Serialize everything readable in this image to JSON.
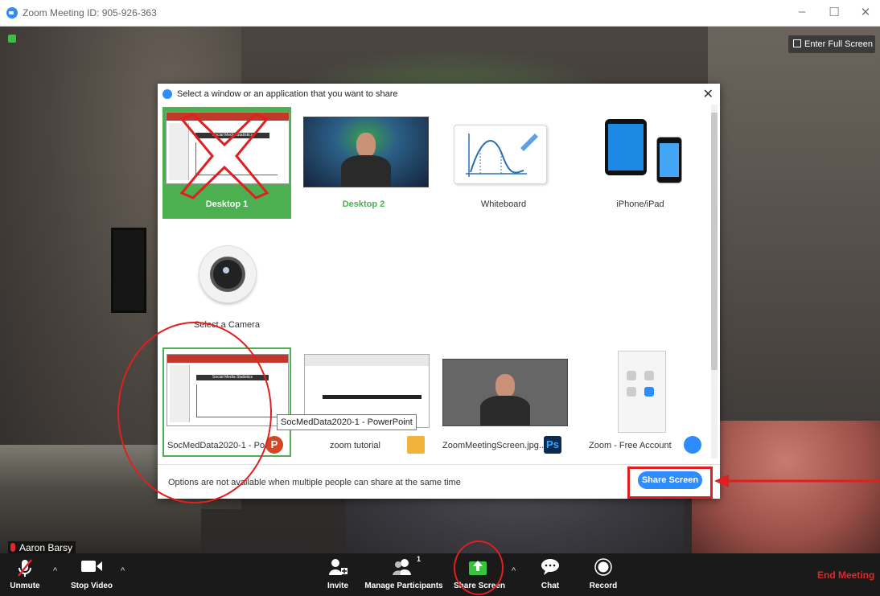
{
  "window": {
    "title": "Zoom Meeting ID: 905-926-363",
    "minimize": "–",
    "maximize": "☐",
    "close": "✕"
  },
  "video": {
    "fullscreen_label": "Enter Full Screen",
    "participant_name": "Aaron Barsy"
  },
  "dialog": {
    "title": "Select a window or an application that you want to share",
    "close": "✕",
    "tiles": [
      {
        "label": "Desktop 1",
        "selected": true
      },
      {
        "label": "Desktop 2"
      },
      {
        "label": "Whiteboard"
      },
      {
        "label": "iPhone/iPad"
      },
      {
        "label": "Select a Camera"
      },
      {
        "label": "SocMedData2020-1 - Po...",
        "app_icon": "powerpoint-icon",
        "app_letter": "P"
      },
      {
        "label": "zoom tutorial",
        "app_icon": "folder-icon"
      },
      {
        "label": "ZoomMeetingScreen.jpg...",
        "app_icon": "photoshop-icon",
        "app_letter": "Ps"
      },
      {
        "label": "Zoom - Free Account",
        "app_icon": "zoom-icon"
      }
    ],
    "slide_title": "Social Media Statistics",
    "tooltip": "SocMedData2020-1 - PowerPoint",
    "footer_note": "Options are not available when multiple people can share at the same time",
    "share_button": "Share Screen"
  },
  "toolbar": {
    "unmute": "Unmute",
    "stop_video": "Stop Video",
    "invite": "Invite",
    "manage_participants": "Manage Participants",
    "participant_count": "1",
    "share_screen": "Share Screen",
    "chat": "Chat",
    "record": "Record",
    "end_meeting": "End Meeting"
  },
  "colors": {
    "accent_blue": "#2d8cff",
    "selected_green": "#4caf50",
    "annotation_red": "#e02020"
  }
}
